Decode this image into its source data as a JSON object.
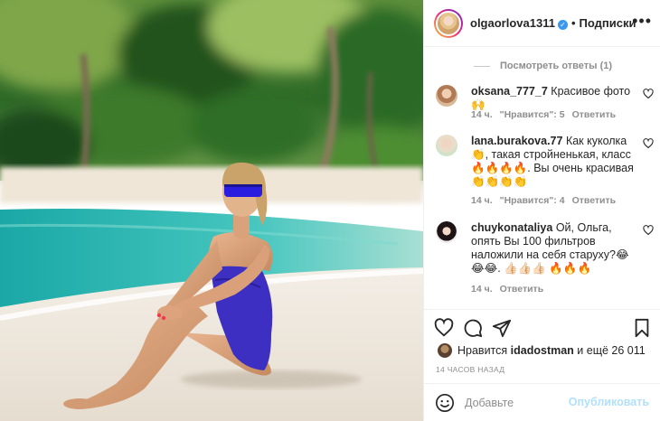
{
  "post": {
    "photo_icon": "beach-photo",
    "colors": {
      "swimsuit": "#3d2fc2",
      "sea": "#27b7b4",
      "sand": "#efe9df",
      "palm": "#3d7f2a"
    }
  },
  "header": {
    "username": "olgaorlova1311",
    "verified_icon": "verified-badge-icon",
    "separator": "•",
    "follow_label": "Подписки",
    "more_label": "•••"
  },
  "comments": {
    "view_replies": "Посмотреть ответы (1)",
    "items": [
      {
        "username": "oksana_777_7",
        "text": "Красивое фото 🙌",
        "time": "14 ч.",
        "likes": "\"Нравится\": 5",
        "reply": "Ответить"
      },
      {
        "username": "lana.burakova.77",
        "text": "Как куколка👏, такая стройненькая, класс 🔥🔥🔥🔥. Вы очень красивая 👏👏👏👏",
        "time": "14 ч.",
        "likes": "\"Нравится\": 4",
        "reply": "Ответить"
      },
      {
        "username": "chuykonataliya",
        "text": "Ой, Ольга, опять Вы 100 фильтров наложили на себя старуху?😂😂😂. 👍🏻👍🏻👍🏻 🔥🔥🔥",
        "time": "14 ч.",
        "reply": "Ответить"
      }
    ]
  },
  "actions": {
    "like_icon": "heart-icon",
    "comment_icon": "comment-icon",
    "share_icon": "paper-plane-icon",
    "save_icon": "bookmark-icon"
  },
  "likes": {
    "prefix": "Нравится",
    "user": "idadostman",
    "suffix": "и ещё 26 011"
  },
  "time_ago": "14 ЧАСОВ НАЗАД",
  "add_comment": {
    "placeholder": "Добавьте",
    "publish_label": "Опубликовать"
  }
}
